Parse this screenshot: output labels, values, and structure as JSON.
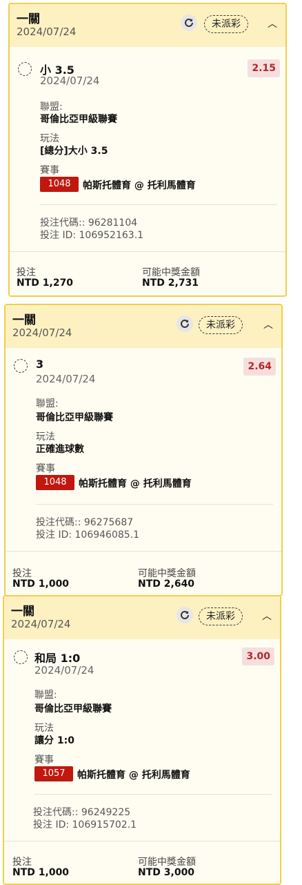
{
  "tickets": [
    {
      "title": "一關",
      "date": "2024/07/24",
      "status": "未派彩",
      "selection": "小 3.5",
      "selection_date": "2024/07/24",
      "odds": "2.15",
      "league_label": "聯盟:",
      "league": "哥倫比亞甲級聯賽",
      "market_label": "玩法",
      "market": "[總分]大小 3.5",
      "event_label": "賽事",
      "event_code": "1048",
      "event_name": "帕斯托體育 @ 托利馬體育",
      "bet_code": "投注代碼:: 96281104",
      "bet_id": "投注 ID: 106952163.1",
      "stake_label": "投注",
      "stake": "NTD 1,270",
      "payout_label": "可能中獎金額",
      "payout": "NTD 2,731"
    },
    {
      "title": "一關",
      "date": "2024/07/24",
      "status": "未派彩",
      "selection": "3",
      "selection_date": "2024/07/24",
      "odds": "2.64",
      "league_label": "聯盟:",
      "league": "哥倫比亞甲級聯賽",
      "market_label": "玩法",
      "market": "正確進球數",
      "event_label": "賽事",
      "event_code": "1048",
      "event_name": "帕斯托體育 @ 托利馬體育",
      "bet_code": "投注代碼:: 96275687",
      "bet_id": "投注 ID: 106946085.1",
      "stake_label": "投注",
      "stake": "NTD 1,000",
      "payout_label": "可能中獎金額",
      "payout": "NTD 2,640"
    },
    {
      "title": "一關",
      "date": "2024/07/24",
      "status": "未派彩",
      "selection": "和局 1:0",
      "selection_date": "2024/07/24",
      "odds": "3.00",
      "league_label": "聯盟:",
      "league": "哥倫比亞甲級聯賽",
      "market_label": "玩法",
      "market": "讓分 1:0",
      "event_label": "賽事",
      "event_code": "1057",
      "event_name": "帕斯托體育 @ 托利馬體育",
      "bet_code": "投注代碼:: 96249225",
      "bet_id": "投注 ID: 106915702.1",
      "stake_label": "投注",
      "stake": "NTD 1,000",
      "payout_label": "可能中獎金額",
      "payout": "NTD 3,000"
    }
  ],
  "icons": {
    "refresh": "refresh-icon",
    "collapse": "chevron-up-icon",
    "pending": "pending-status-icon"
  },
  "colors": {
    "header_bg": "#fdf1c2",
    "border": "#f0cf45",
    "odds_text": "#b02a2a",
    "odds_bg": "#f6dede",
    "event_badge": "#c0180f"
  }
}
